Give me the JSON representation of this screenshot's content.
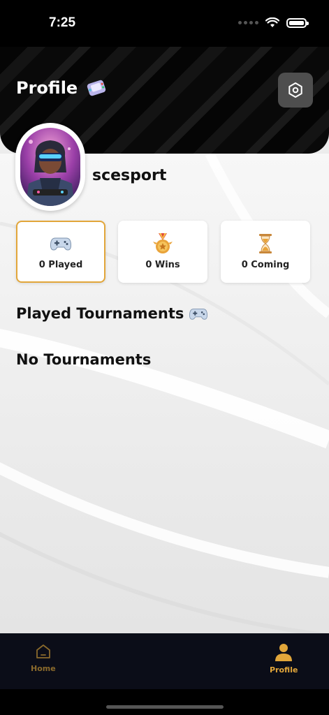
{
  "status_bar": {
    "time": "7:25"
  },
  "header": {
    "title": "Profile"
  },
  "profile": {
    "username": "scesport"
  },
  "stats": [
    {
      "label": "0 Played",
      "icon": "gamepad-icon"
    },
    {
      "label": "0 Wins",
      "icon": "medal-icon"
    },
    {
      "label": "0 Coming",
      "icon": "hourglass-icon"
    }
  ],
  "tournaments": {
    "section_title": "Played Tournaments",
    "empty_message": "No Tournaments"
  },
  "nav": {
    "home_label": "Home",
    "profile_label": "Profile"
  },
  "colors": {
    "accent": "#e2a63a",
    "nav_background": "#0b0d18",
    "nav_inactive": "#8a6a2c"
  }
}
